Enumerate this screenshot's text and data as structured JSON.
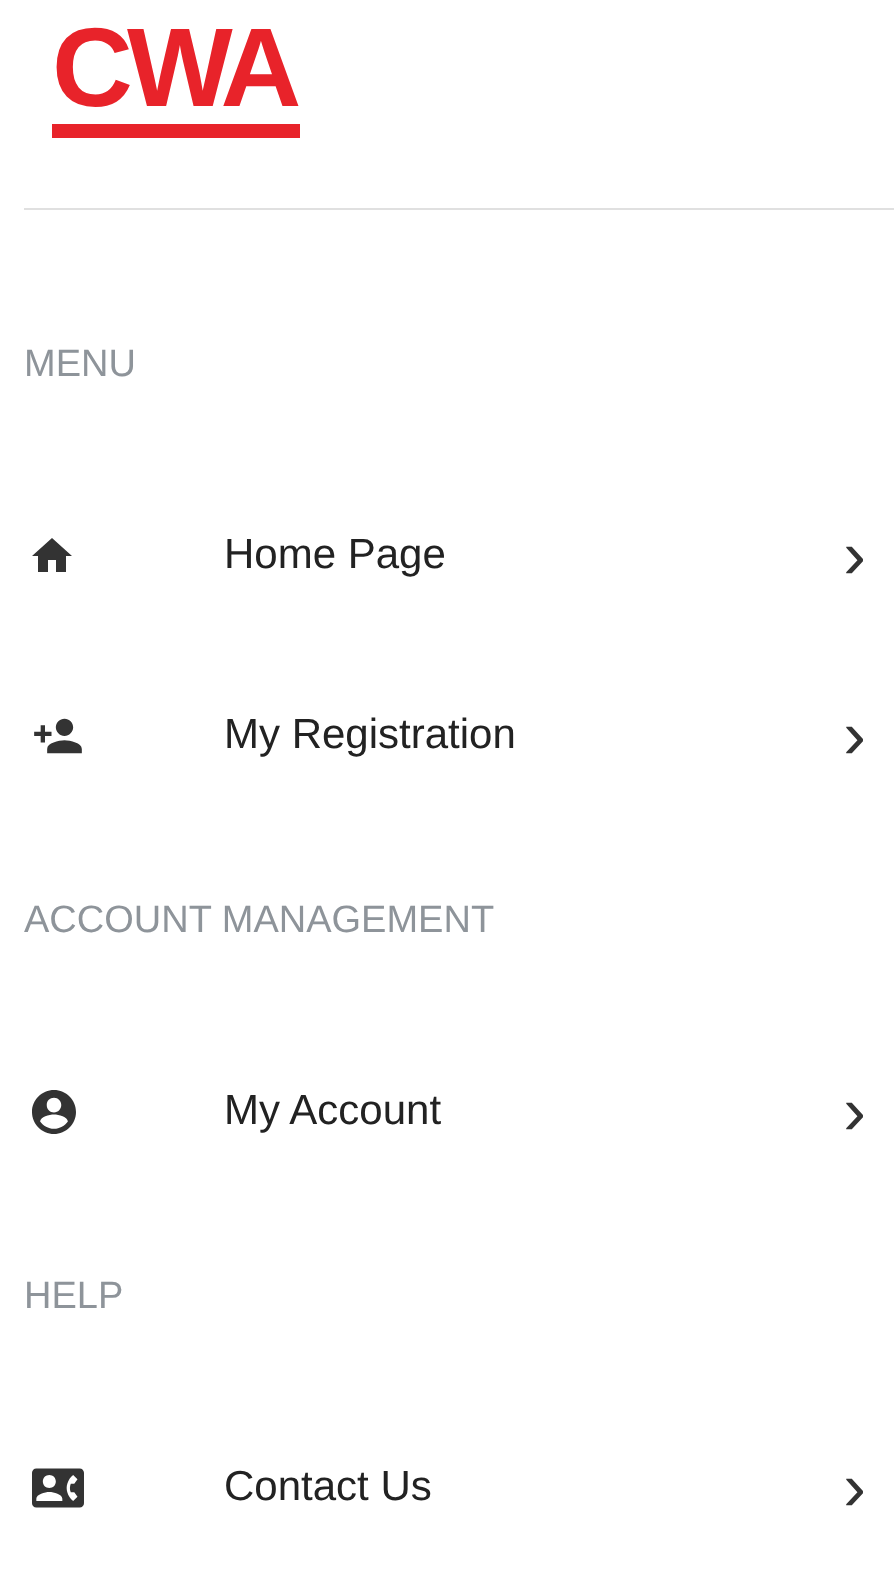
{
  "logo": {
    "text": "CWA"
  },
  "sections": [
    {
      "title": "MENU",
      "items": [
        {
          "kind": "home",
          "label": "Home Page",
          "chevron": "›"
        },
        {
          "kind": "add-person",
          "label": "My Registration",
          "chevron": "›"
        }
      ]
    },
    {
      "title": "ACCOUNT MANAGEMENT",
      "items": [
        {
          "kind": "account",
          "label": "My Account",
          "chevron": "›"
        }
      ]
    },
    {
      "title": "HELP",
      "items": [
        {
          "kind": "contact",
          "label": "Contact Us",
          "chevron": "›"
        }
      ]
    }
  ]
}
